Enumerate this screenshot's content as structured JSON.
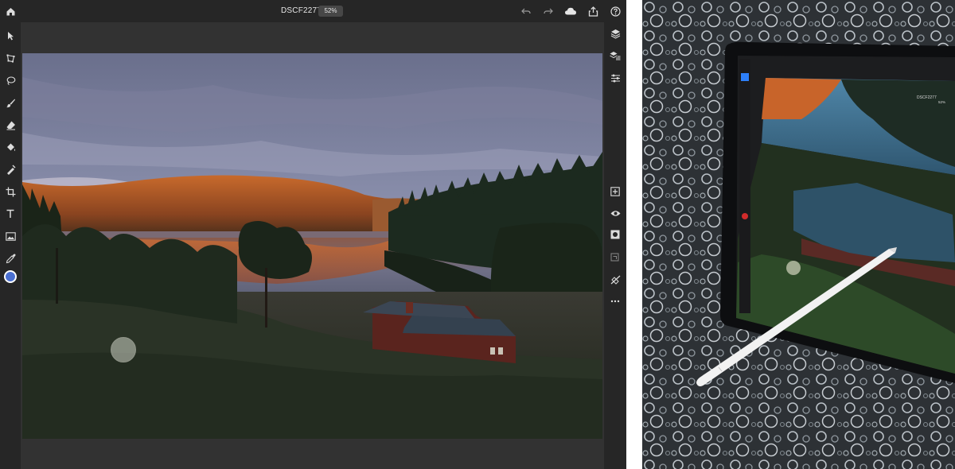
{
  "app": {
    "doc_title": "DSCF2277",
    "zoom_level": "52%"
  },
  "topbar": {
    "icons": [
      "home-icon",
      "undo-icon",
      "redo-icon",
      "cloud-icon",
      "share-icon",
      "help-icon"
    ]
  },
  "left_toolbar": {
    "tools": [
      "select-icon",
      "transform-icon",
      "lasso-icon",
      "brush-icon",
      "eraser-icon",
      "fill-icon",
      "healing-icon",
      "crop-icon",
      "type-icon",
      "image-icon",
      "eyedropper-icon"
    ],
    "foreground_color": "#4a6fd1",
    "background_color": "#ffffff"
  },
  "right_toolbar": {
    "icons": [
      "layers-icon",
      "layer-properties-icon",
      "adjustments-icon",
      "add-layer-icon",
      "visibility-icon",
      "mask-icon",
      "group-icon",
      "clipping-icon",
      "more-icon"
    ]
  },
  "colors": {
    "app_bg": "#323232",
    "toolbar_bg": "#262626",
    "accent": "#2d7ff9"
  },
  "photo_tablet": {
    "doc_title": "DSCF2277",
    "zoom_level": "52%"
  }
}
